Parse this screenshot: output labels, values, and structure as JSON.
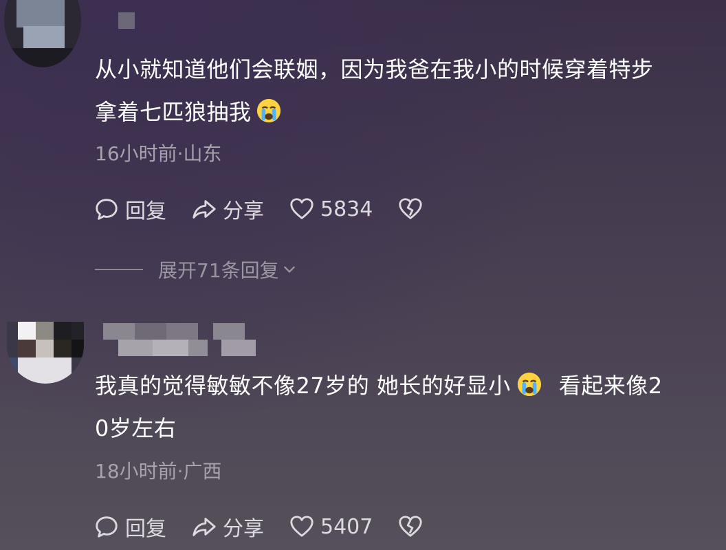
{
  "comments": [
    {
      "text_line1": "从小就知道他们会联姻，因为我爸在我小的时候穿着特步",
      "text_line2": "拿着七匹狼抽我",
      "meta": "16小时前·山东",
      "reply_label": "回复",
      "share_label": "分享",
      "like_count": "5834",
      "expand_label": "展开71条回复"
    },
    {
      "text_line1_a": "我真的觉得敏敏不像27岁的 她长的好显小",
      "text_line1_b": "看起来像2",
      "text_line2": "0岁左右",
      "meta": "18小时前·广西",
      "reply_label": "回复",
      "share_label": "分享",
      "like_count": "5407"
    }
  ],
  "icons": {
    "reply": "comment-bubble-icon",
    "share": "share-arrow-icon",
    "like": "heart-icon",
    "dislike": "broken-heart-icon",
    "expand": "chevron-down-icon",
    "emoji": "crying-face-emoji"
  },
  "colors": {
    "background_top": "#3b3048",
    "background_bottom": "#55505a",
    "text_primary": "#ffffff",
    "text_secondary": "#a7a2ad",
    "action_color": "#dcd9df"
  }
}
